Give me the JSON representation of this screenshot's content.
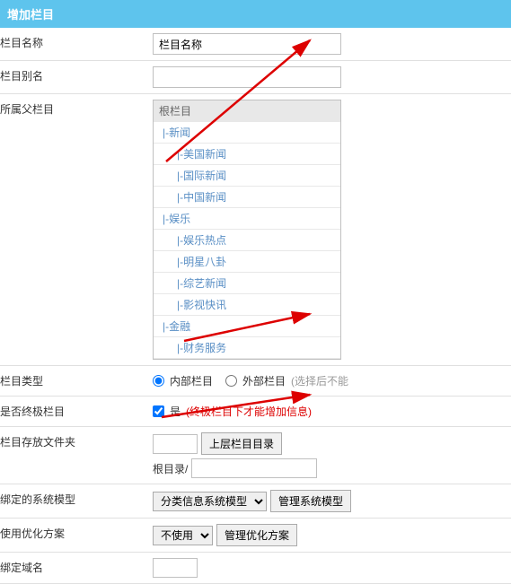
{
  "header": {
    "title": "增加栏目"
  },
  "rows": {
    "name": {
      "label": "栏目名称",
      "value": "栏目名称"
    },
    "alias": {
      "label": "栏目别名",
      "value": ""
    },
    "parent": {
      "label": "所属父栏目",
      "tree": {
        "root": "根栏目",
        "items": [
          {
            "text": "|-新闻",
            "lvl": 1
          },
          {
            "text": "|-美国新闻",
            "lvl": 2
          },
          {
            "text": "|-国际新闻",
            "lvl": 2
          },
          {
            "text": "|-中国新闻",
            "lvl": 2
          },
          {
            "text": "|-娱乐",
            "lvl": 1
          },
          {
            "text": "|-娱乐热点",
            "lvl": 2
          },
          {
            "text": "|-明星八卦",
            "lvl": 2
          },
          {
            "text": "|-综艺新闻",
            "lvl": 2
          },
          {
            "text": "|-影视快讯",
            "lvl": 2
          },
          {
            "text": "|-金融",
            "lvl": 1
          },
          {
            "text": "|-财务服务",
            "lvl": 2
          }
        ]
      }
    },
    "type": {
      "label": "栏目类型",
      "opt_internal": "内部栏目",
      "opt_external": "外部栏目",
      "hint": "(选择后不能"
    },
    "terminal": {
      "label": "是否终极栏目",
      "check_label": "是",
      "hint": "(终极栏目下才能增加信息)"
    },
    "folder": {
      "label": "栏目存放文件夹",
      "btn_upper": "上层栏目目录",
      "root_prefix": "根目录/"
    },
    "model": {
      "label": "绑定的系统模型",
      "selected": "分类信息系统模型",
      "btn_manage": "管理系统模型"
    },
    "optimize": {
      "label": "使用优化方案",
      "selected": "不使用",
      "btn_manage": "管理优化方案"
    },
    "domain": {
      "label": "绑定域名"
    }
  }
}
